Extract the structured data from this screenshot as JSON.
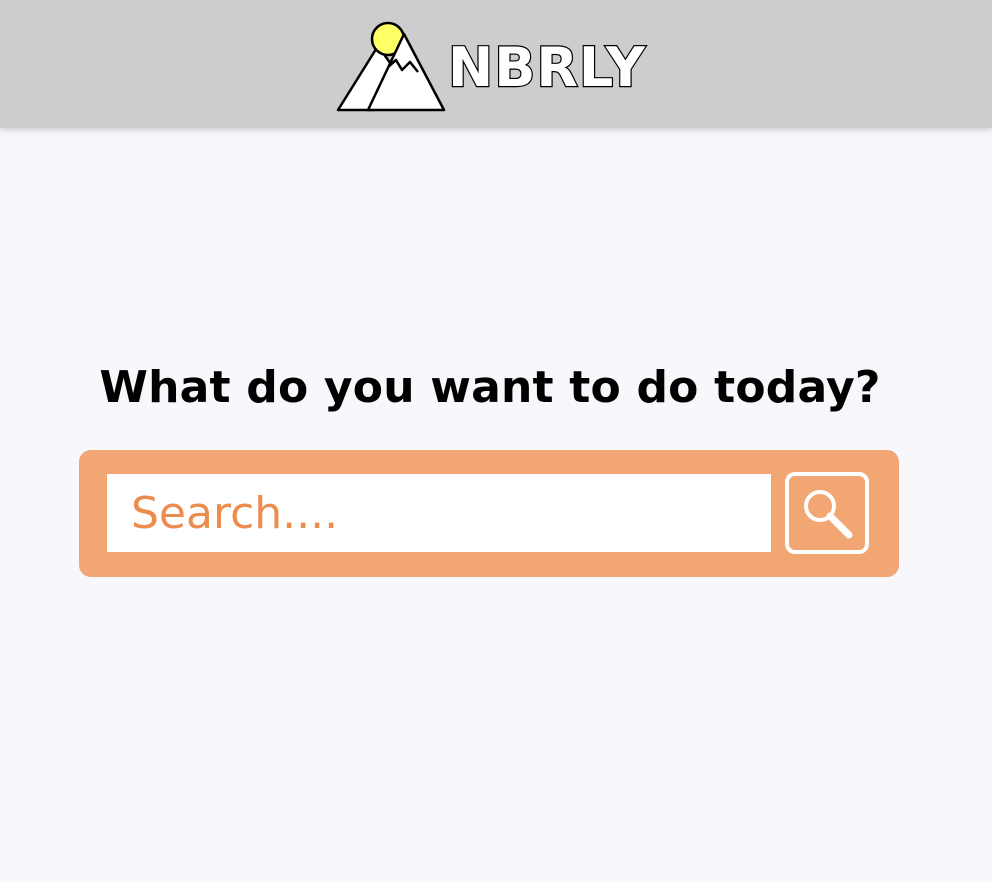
{
  "header": {
    "brand_name": "NBRLY",
    "logo_icon": "mountains-sun-icon"
  },
  "main": {
    "heading": "What do you want to do today?",
    "search": {
      "placeholder": "Search....",
      "value": "",
      "button_icon": "magnifier-icon"
    }
  },
  "colors": {
    "header_bg": "#cdcdcd",
    "page_bg": "#f7f7fc",
    "accent": "#f2a674",
    "search_text": "#ec8d4f",
    "sun": "#ffff66"
  }
}
